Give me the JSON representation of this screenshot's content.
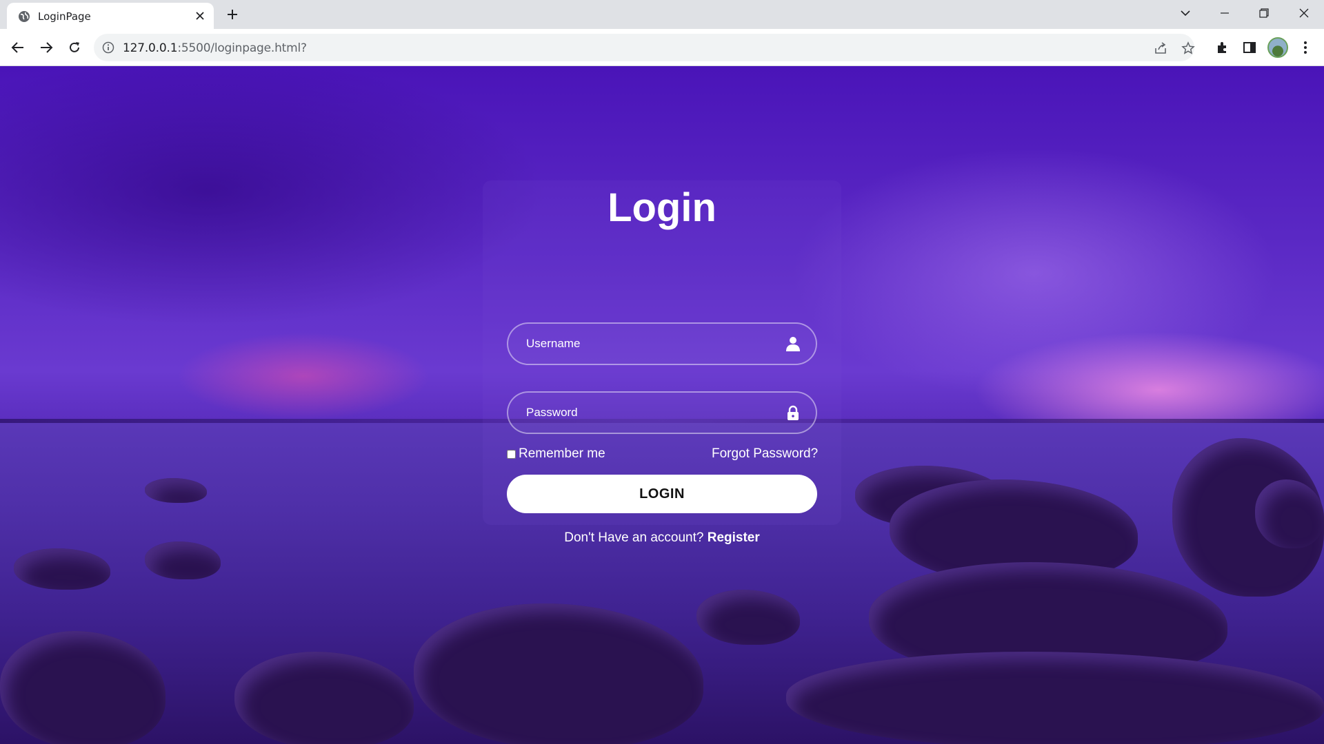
{
  "browser": {
    "tab_title": "LoginPage",
    "url_host": "127.0.0.1",
    "url_path": ":5500/loginpage.html?"
  },
  "login": {
    "title": "Login",
    "username_placeholder": "Username",
    "password_placeholder": "Password",
    "remember_label": "Remember me",
    "forgot_label": "Forgot Password?",
    "button_label": "LOGIN",
    "no_account_text": "Don't Have an account?",
    "register_label": "Register"
  },
  "colors": {
    "background_primary": "#4a14b8",
    "button_bg": "#ffffff",
    "text": "#ffffff"
  }
}
